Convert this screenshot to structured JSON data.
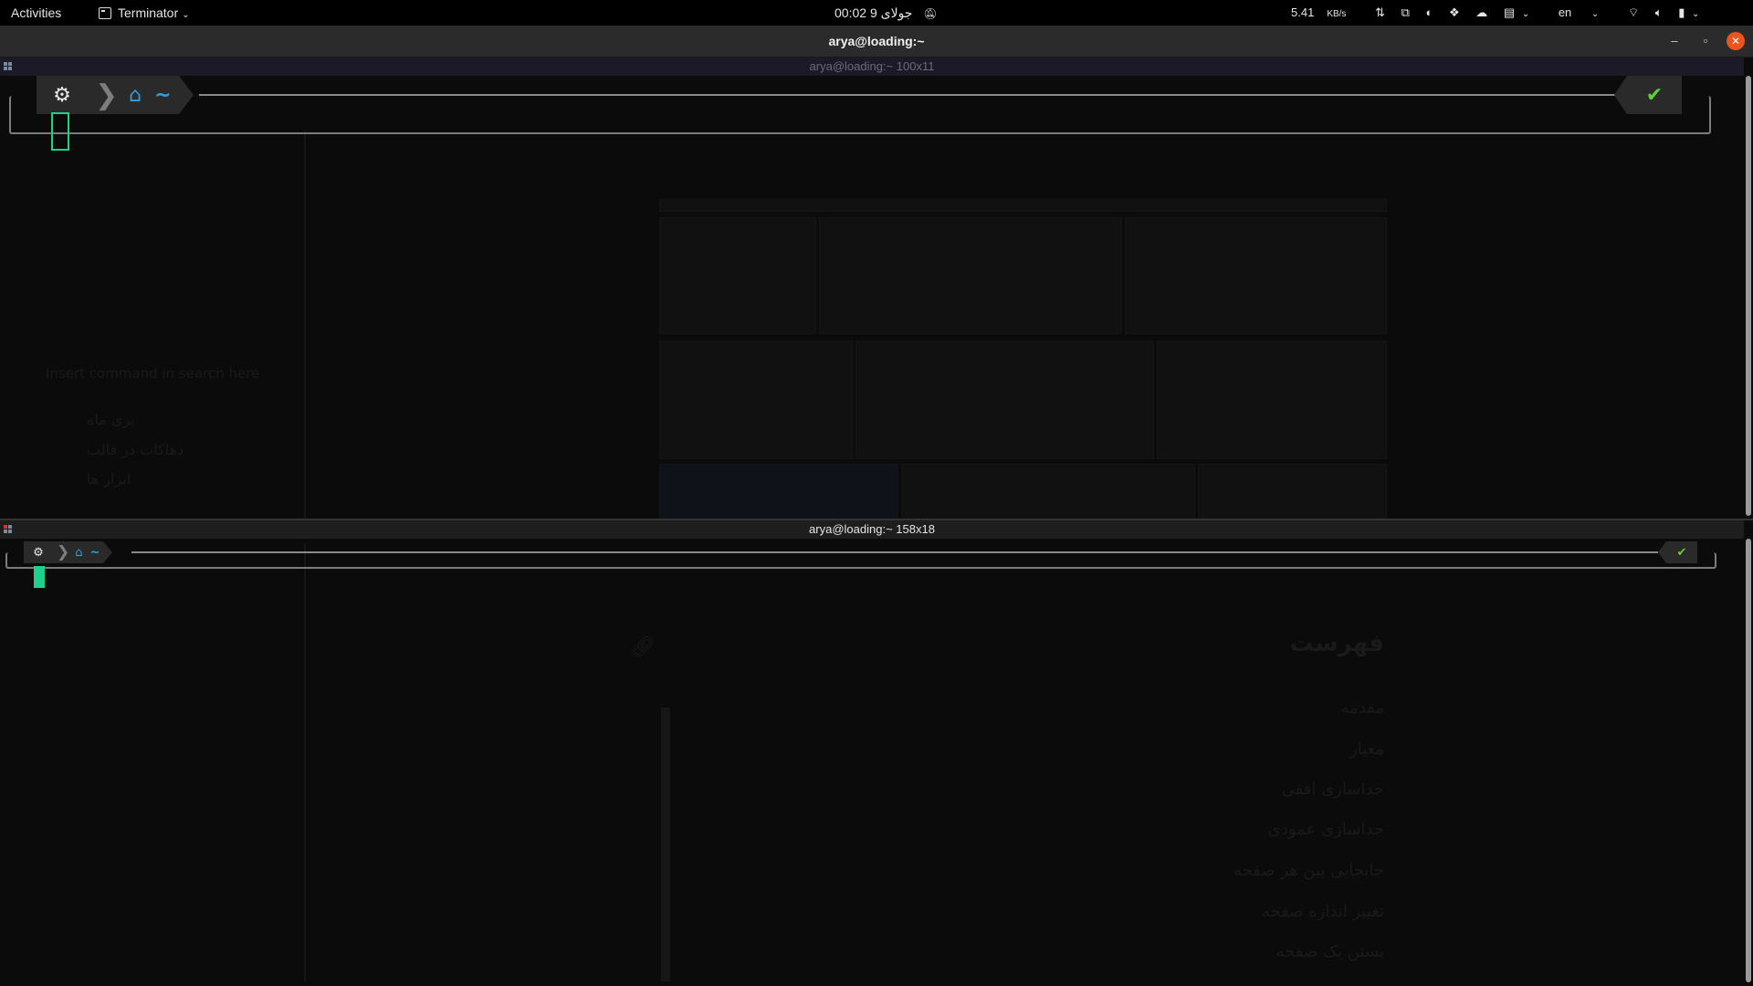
{
  "topbar": {
    "activities": "Activities",
    "app_name": "Terminator",
    "clock": "00:02 جولای 9",
    "net_speed_value": "5.41",
    "net_speed_unit": "KB/s",
    "language": "en"
  },
  "window": {
    "title": "arya@loading:~",
    "minimize": "–",
    "maximize": "▫",
    "close": "✕"
  },
  "pane_top": {
    "title": "arya@loading:~ 100x11",
    "dir_glyph": "~",
    "status": "✔"
  },
  "pane_bottom": {
    "title": "arya@loading:~ 158x18",
    "dir_glyph": "~",
    "status": "✔"
  },
  "ghost": {
    "line1": "Insert command in search here",
    "menu": [
      "پری ماه",
      "ذهاکات‌ در قالب",
      "ابزار ها"
    ],
    "toc_title": "فهرست",
    "toc_items": [
      "مقدمه",
      "معیار",
      "جداسازی افقی",
      "جداسازی عمودی",
      "جابجایی بین هر صفحه",
      "تغییر اندازه صفحه",
      "بستن یک صفحه"
    ]
  },
  "colors": {
    "accent_close": "#e95420",
    "prompt_dir": "#2ea0e0",
    "status_ok": "#5fcf34",
    "cursor": "#1fd08a"
  }
}
